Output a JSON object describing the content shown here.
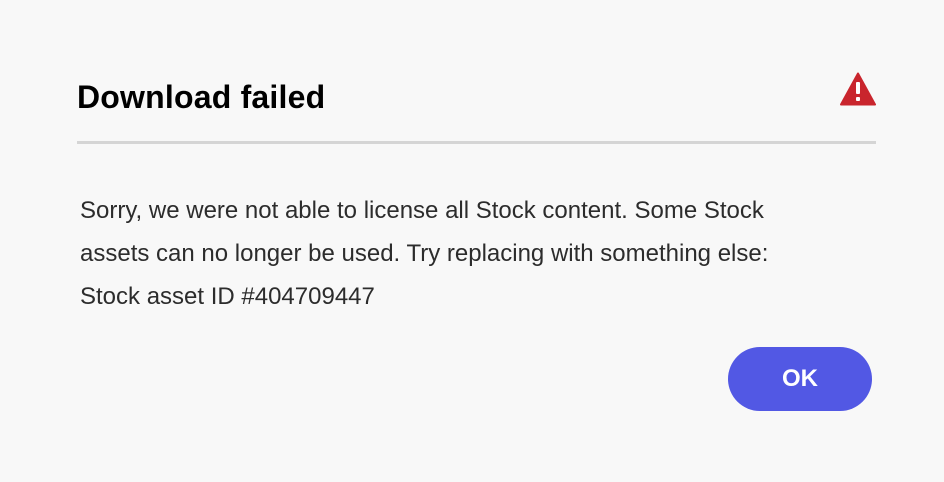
{
  "dialog": {
    "title": "Download failed",
    "icon": "alert-triangle-icon",
    "message": "Sorry, we were not able to license all Stock content. Some Stock assets can no longer be used. Try replacing with something else: Stock asset ID #404709447",
    "ok_label": "OK"
  },
  "colors": {
    "background": "#f8f8f8",
    "alert": "#c9252d",
    "button": "#5258e4",
    "divider": "#d5d5d5"
  }
}
